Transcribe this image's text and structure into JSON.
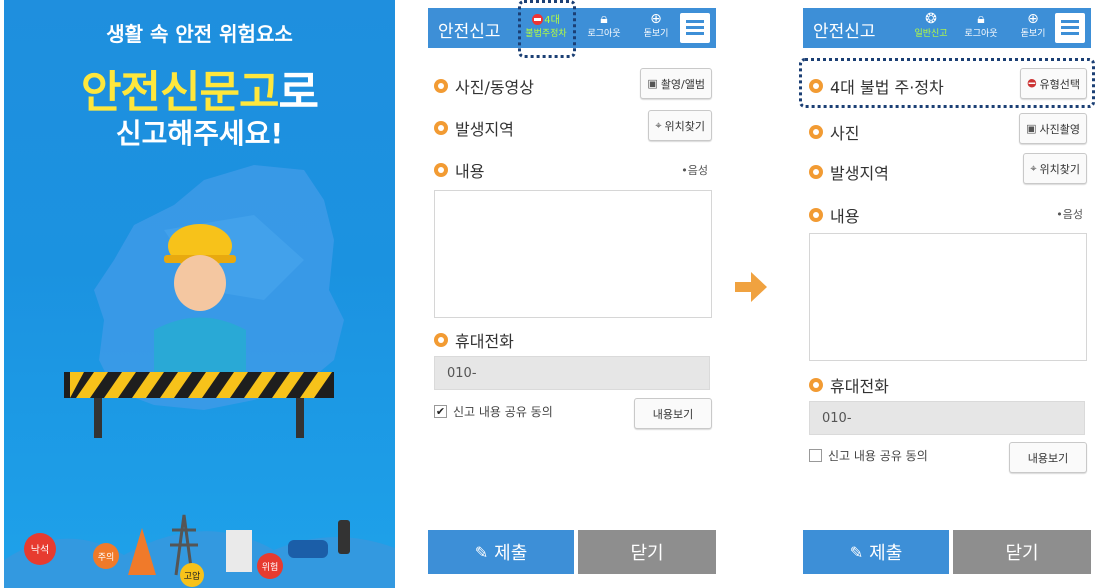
{
  "splash": {
    "subtitle": "생활 속 안전 위험요소",
    "title_highlight": "안전신문고",
    "title_suffix": "로",
    "line2": "신고해주세요!",
    "signs": [
      "낙석",
      "주의",
      "고압",
      "위험"
    ],
    "colors": {
      "background": "#1f8fde",
      "highlight": "#ffe73c"
    }
  },
  "arrow_icon": "arrow-right-icon",
  "phone1": {
    "appbar": {
      "title": "안전신고",
      "buttons": [
        {
          "icon": "no-entry-icon",
          "label_top": "4대",
          "label": "불법주정차"
        },
        {
          "icon": "lock-icon",
          "label": "로그아웃"
        },
        {
          "icon": "zoom-icon",
          "label": "돋보기"
        }
      ],
      "menu_icon": "hamburger-icon"
    },
    "fields": {
      "media_label": "사진/동영상",
      "media_button": "촬영/앨범",
      "location_label": "발생지역",
      "location_button": "위치찾기",
      "content_label": "내용",
      "voice_button": "음성",
      "phone_label": "휴대전화",
      "phone_value": "010-",
      "agree_label": "신고 내용 공유 동의",
      "agree_checked": true,
      "view_button": "내용보기"
    },
    "bottom": {
      "submit": "제출",
      "close": "닫기"
    }
  },
  "phone2": {
    "appbar": {
      "title": "안전신고",
      "buttons": [
        {
          "icon": "siren-icon",
          "label": "일반신고"
        },
        {
          "icon": "lock-icon",
          "label": "로그아웃"
        },
        {
          "icon": "zoom-icon",
          "label": "돋보기"
        }
      ],
      "menu_icon": "hamburger-icon"
    },
    "fields": {
      "type_label": "4대 불법 주·정차",
      "type_button": "유형선택",
      "photo_label": "사진",
      "photo_button": "사진촬영",
      "location_label": "발생지역",
      "location_button": "위치찾기",
      "content_label": "내용",
      "voice_button": "음성",
      "phone_label": "휴대전화",
      "phone_value": "010-",
      "agree_label": "신고 내용 공유 동의",
      "agree_checked": false,
      "view_button": "내용보기"
    },
    "bottom": {
      "submit": "제출",
      "close": "닫기"
    }
  }
}
